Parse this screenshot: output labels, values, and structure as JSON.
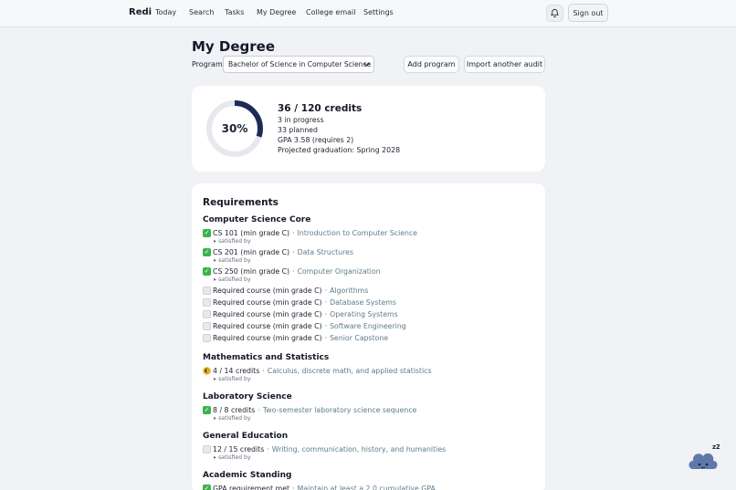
{
  "nav": {
    "brand": "Redi",
    "links": [
      "Today",
      "Search",
      "Tasks",
      "My Degree",
      "College email",
      "Settings"
    ],
    "sign_out": "Sign out",
    "bell_icon": "bell-icon"
  },
  "header": {
    "title": "My Degree",
    "program_label": "Program",
    "program_value": "Bachelor of Science in Computer Science",
    "add_program": "Add program",
    "import_audit": "Import another audit"
  },
  "progress": {
    "percent_label": "30%",
    "percent": 30,
    "credits": "36 / 120 credits",
    "in_progress": "3 in progress",
    "planned": "33 planned",
    "gpa": "GPA 3.58 (requires 2)",
    "graduation": "Projected graduation: Spring 2028",
    "ring_color": "#1f2b57",
    "track_color": "#e6e8ee"
  },
  "requirements": {
    "title": "Requirements",
    "satisfied_by": "▸ satisfied by",
    "groups": [
      {
        "name": "Computer Science Core",
        "items": [
          {
            "status": "done",
            "code": "CS 101 (min grade C)",
            "desc": "Introduction to Computer Science",
            "satisfied": true
          },
          {
            "status": "done",
            "code": "CS 201 (min grade C)",
            "desc": "Data Structures",
            "satisfied": true
          },
          {
            "status": "done",
            "code": "CS 250 (min grade C)",
            "desc": "Computer Organization",
            "satisfied": true
          },
          {
            "status": "todo",
            "code": "Required course (min grade C)",
            "desc": "Algorithms",
            "satisfied": false
          },
          {
            "status": "todo",
            "code": "Required course (min grade C)",
            "desc": "Database Systems",
            "satisfied": false
          },
          {
            "status": "todo",
            "code": "Required course (min grade C)",
            "desc": "Operating Systems",
            "satisfied": false
          },
          {
            "status": "todo",
            "code": "Required course (min grade C)",
            "desc": "Software Engineering",
            "satisfied": false
          },
          {
            "status": "todo",
            "code": "Required course (min grade C)",
            "desc": "Senior Capstone",
            "satisfied": false
          }
        ]
      },
      {
        "name": "Mathematics and Statistics",
        "items": [
          {
            "status": "partial",
            "code": "4 / 14 credits",
            "desc": "Calculus, discrete math, and applied statistics",
            "satisfied": true
          }
        ]
      },
      {
        "name": "Laboratory Science",
        "items": [
          {
            "status": "done",
            "code": "8 / 8 credits",
            "desc": "Two-semester laboratory science sequence",
            "satisfied": true
          }
        ]
      },
      {
        "name": "General Education",
        "items": [
          {
            "status": "todo",
            "code": "12 / 15 credits",
            "desc": "Writing, communication, history, and humanities",
            "satisfied": true
          }
        ]
      },
      {
        "name": "Academic Standing",
        "items": [
          {
            "status": "done",
            "code": "GPA requirement met",
            "desc": "Maintain at least a 2.0 cumulative GPA",
            "satisfied": false
          }
        ]
      }
    ]
  },
  "mascot": {
    "icon": "sleeping-cloud-icon",
    "zz": "zZ"
  }
}
